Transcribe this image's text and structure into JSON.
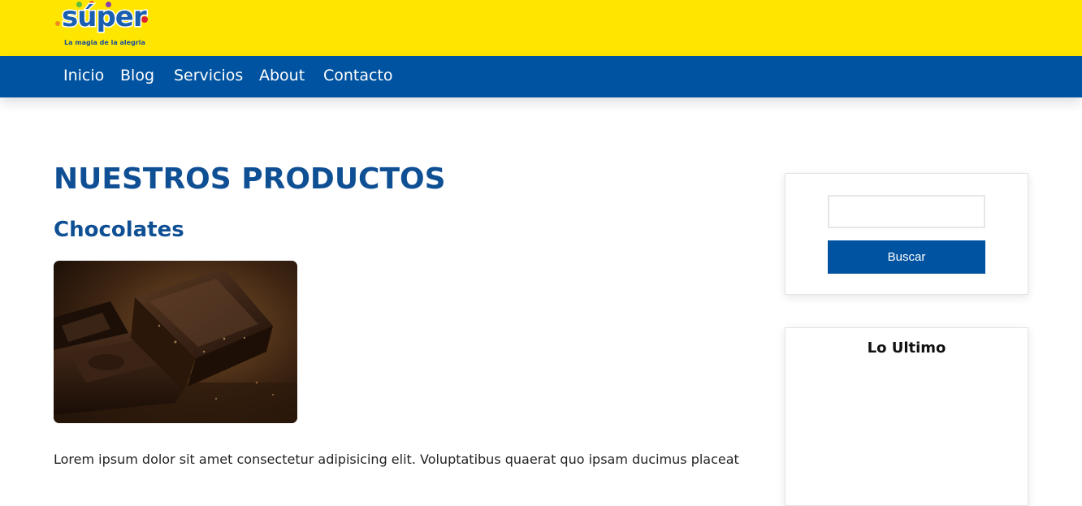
{
  "brand": {
    "logo_text": "súper",
    "tagline": "La magia de la alegria",
    "colors": {
      "yellow": "#ffe600",
      "blue": "#0053a0",
      "title_blue": "#0f4f94"
    }
  },
  "nav": {
    "items": [
      {
        "label": "Inicio"
      },
      {
        "label": "Blog"
      },
      {
        "label": "Servicios"
      },
      {
        "label": "About"
      },
      {
        "label": "Contacto"
      }
    ]
  },
  "main": {
    "title": "NUESTROS PRODUCTOS",
    "section_title": "Chocolates",
    "image_alt_icon": "chocolate-image",
    "body_text": "Lorem ipsum dolor sit amet consectetur adipisicing elit. Voluptatibus quaerat quo ipsam ducimus placeat"
  },
  "sidebar": {
    "search": {
      "value": "",
      "placeholder": "",
      "button_label": "Buscar"
    },
    "latest": {
      "title": "Lo Ultimo"
    }
  }
}
